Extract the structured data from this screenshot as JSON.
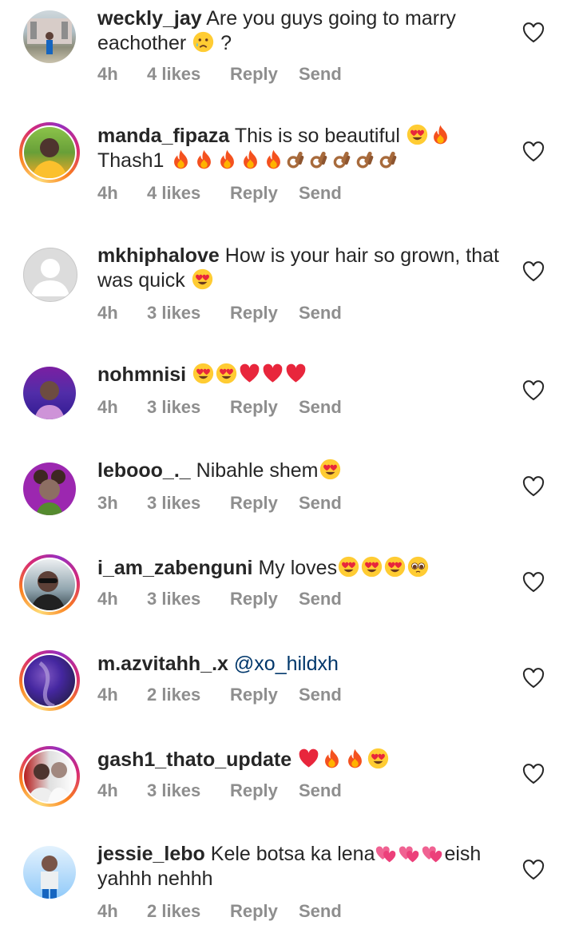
{
  "comments": [
    {
      "username": "weckly_jay",
      "line1": "Are you guys going to marry",
      "line2": "eachother",
      "line2_suffix": "?",
      "time": "4h",
      "likes": "4 likes",
      "reply": "Reply",
      "send": "Send"
    },
    {
      "username": "manda_fipaza",
      "line1": "This is so beautiful",
      "line2": "Thash1",
      "time": "4h",
      "likes": "4 likes",
      "reply": "Reply",
      "send": "Send"
    },
    {
      "username": "mkhiphalove",
      "line1": "How is your hair so grown, that",
      "line2": "was quick",
      "time": "4h",
      "likes": "3 likes",
      "reply": "Reply",
      "send": "Send"
    },
    {
      "username": "nohmnisi",
      "line1": "",
      "time": "4h",
      "likes": "3 likes",
      "reply": "Reply",
      "send": "Send"
    },
    {
      "username": "lebooo_._",
      "line1": "Nibahle shem",
      "time": "3h",
      "likes": "3 likes",
      "reply": "Reply",
      "send": "Send"
    },
    {
      "username": "i_am_zabenguni",
      "line1": "My loves",
      "time": "4h",
      "likes": "3 likes",
      "reply": "Reply",
      "send": "Send"
    },
    {
      "username": "m.azvitahh_.x",
      "mention": "@xo_hildxh",
      "time": "4h",
      "likes": "2 likes",
      "reply": "Reply",
      "send": "Send"
    },
    {
      "username": "gash1_thato_update",
      "line1": "",
      "time": "4h",
      "likes": "3 likes",
      "reply": "Reply",
      "send": "Send"
    },
    {
      "username": "jessie_lebo",
      "line1": "Kele botsa ka lena",
      "line1_suffix": "eish",
      "line2": "yahhh nehhh",
      "time": "4h",
      "likes": "2 likes",
      "reply": "Reply",
      "send": "Send"
    }
  ]
}
